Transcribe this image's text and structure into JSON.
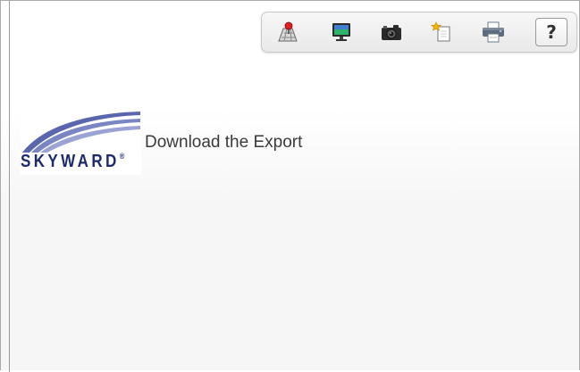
{
  "toolbar": {
    "icons": [
      {
        "name": "map-pin-icon"
      },
      {
        "name": "monitor-icon"
      },
      {
        "name": "camera-icon"
      },
      {
        "name": "new-document-icon"
      },
      {
        "name": "printer-icon"
      }
    ],
    "help_label": "?"
  },
  "logo": {
    "text": "SKYWARD",
    "mark": "®"
  },
  "page": {
    "title": "Download the Export"
  },
  "colors": {
    "logo_navy": "#1d2a6c",
    "logo_swoosh": "#7a86c4",
    "toolbar_bg": "#eeeeee",
    "title_text": "#3a3a3a"
  }
}
